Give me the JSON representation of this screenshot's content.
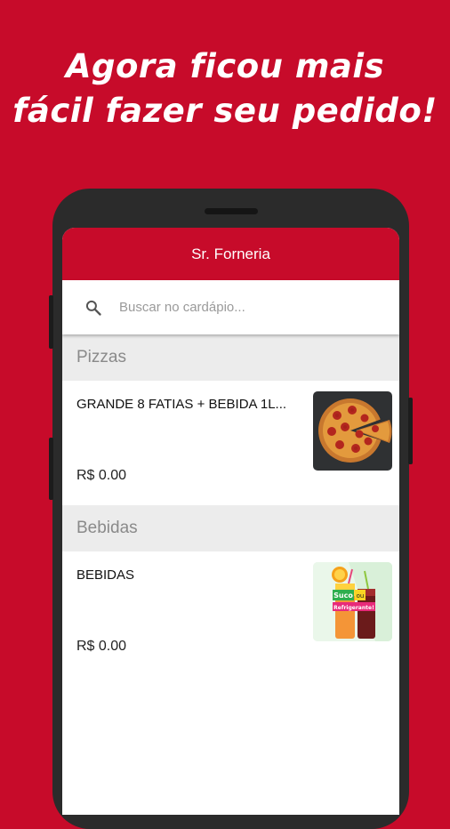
{
  "headline": {
    "line1": "Agora ficou mais",
    "line2": "fácil fazer seu pedido!"
  },
  "app": {
    "title": "Sr. Forneria",
    "search": {
      "placeholder": "Buscar no cardápio..."
    }
  },
  "menu": {
    "sections": [
      {
        "title": "Pizzas",
        "items": [
          {
            "name": "GRANDE 8 FATIAS + BEBIDA 1L...",
            "price": "R$ 0.00",
            "image_icon": "pepperoni-pizza-image"
          }
        ]
      },
      {
        "title": "Bebidas",
        "items": [
          {
            "name": "BEBIDAS",
            "price": "R$ 0.00",
            "image_icon": "juice-soda-image"
          }
        ]
      }
    ],
    "thumb_texts": {
      "suco": "Suco",
      "ou": "ou",
      "refrigerante": "Refrigerante!"
    }
  },
  "colors": {
    "brand": "#c70b2a",
    "section_bg": "#ececec",
    "phone_body": "#2b2b2b"
  }
}
